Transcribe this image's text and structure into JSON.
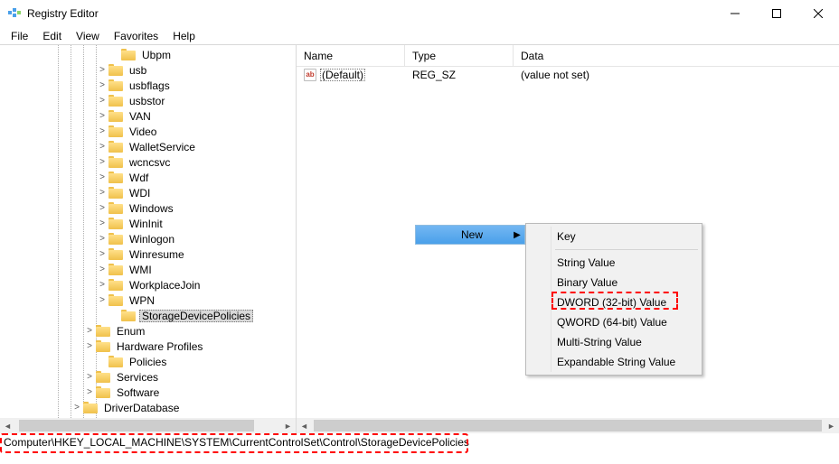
{
  "window": {
    "title": "Registry Editor"
  },
  "menu": [
    "File",
    "Edit",
    "View",
    "Favorites",
    "Help"
  ],
  "tree": {
    "dotlines": [
      64,
      78,
      92,
      106
    ],
    "items": [
      {
        "indent": 120,
        "toggle": "",
        "label": "Ubpm"
      },
      {
        "indent": 106,
        "toggle": ">",
        "label": "usb"
      },
      {
        "indent": 106,
        "toggle": ">",
        "label": "usbflags"
      },
      {
        "indent": 106,
        "toggle": ">",
        "label": "usbstor"
      },
      {
        "indent": 106,
        "toggle": ">",
        "label": "VAN"
      },
      {
        "indent": 106,
        "toggle": ">",
        "label": "Video"
      },
      {
        "indent": 106,
        "toggle": ">",
        "label": "WalletService"
      },
      {
        "indent": 106,
        "toggle": ">",
        "label": "wcncsvc"
      },
      {
        "indent": 106,
        "toggle": ">",
        "label": "Wdf"
      },
      {
        "indent": 106,
        "toggle": ">",
        "label": "WDI"
      },
      {
        "indent": 106,
        "toggle": ">",
        "label": "Windows"
      },
      {
        "indent": 106,
        "toggle": ">",
        "label": "WinInit"
      },
      {
        "indent": 106,
        "toggle": ">",
        "label": "Winlogon"
      },
      {
        "indent": 106,
        "toggle": ">",
        "label": "Winresume"
      },
      {
        "indent": 106,
        "toggle": ">",
        "label": "WMI"
      },
      {
        "indent": 106,
        "toggle": ">",
        "label": "WorkplaceJoin"
      },
      {
        "indent": 106,
        "toggle": ">",
        "label": "WPN"
      },
      {
        "indent": 120,
        "toggle": "",
        "label": "StorageDevicePolicies",
        "selected": true
      },
      {
        "indent": 92,
        "toggle": ">",
        "label": "Enum"
      },
      {
        "indent": 92,
        "toggle": ">",
        "label": "Hardware Profiles"
      },
      {
        "indent": 106,
        "toggle": "",
        "label": "Policies"
      },
      {
        "indent": 92,
        "toggle": ">",
        "label": "Services"
      },
      {
        "indent": 92,
        "toggle": ">",
        "label": "Software"
      },
      {
        "indent": 78,
        "toggle": ">",
        "label": "DriverDatabase"
      }
    ]
  },
  "list": {
    "columns": {
      "name": "Name",
      "type": "Type",
      "data": "Data"
    },
    "rows": [
      {
        "icon": "ab",
        "name": "(Default)",
        "type": "REG_SZ",
        "data": "(value not set)"
      }
    ]
  },
  "context_submenu": {
    "label": "New"
  },
  "context_menu": {
    "items": [
      "Key",
      "---",
      "String Value",
      "Binary Value",
      "DWORD (32-bit) Value",
      "QWORD (64-bit) Value",
      "Multi-String Value",
      "Expandable String Value"
    ],
    "highlight_index": 4
  },
  "statusbar": {
    "path": "Computer\\HKEY_LOCAL_MACHINE\\SYSTEM\\CurrentControlSet\\Control\\StorageDevicePolicies"
  }
}
